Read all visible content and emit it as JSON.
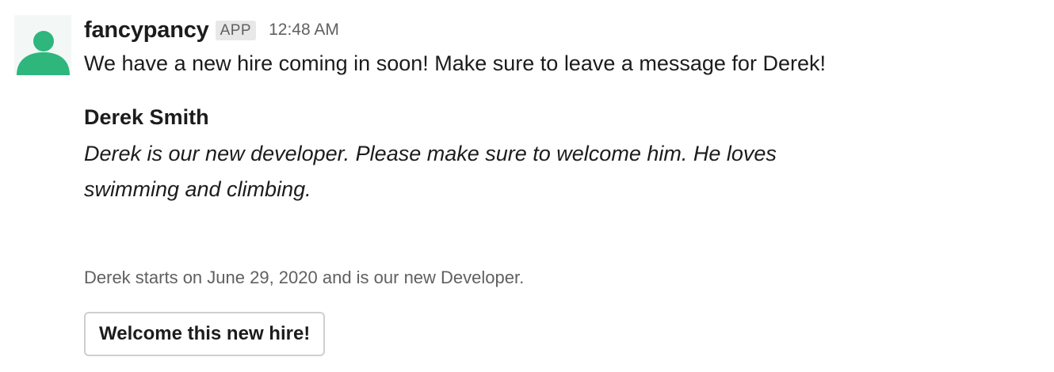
{
  "message": {
    "username": "fancypancy",
    "badge": "APP",
    "timestamp": "12:48 AM",
    "text": "We have a new hire coming in soon! Make sure to leave a message for Derek!",
    "avatar_icon": "user-silhouette-icon",
    "avatar_color": "#2eb67d"
  },
  "new_hire": {
    "name": "Derek Smith",
    "description": "Derek is our new developer. Please make sure to welcome him. He loves swimming and climbing."
  },
  "context": {
    "text": "Derek starts on June 29, 2020 and is our new Developer."
  },
  "actions": {
    "welcome_label": "Welcome this new hire!"
  }
}
